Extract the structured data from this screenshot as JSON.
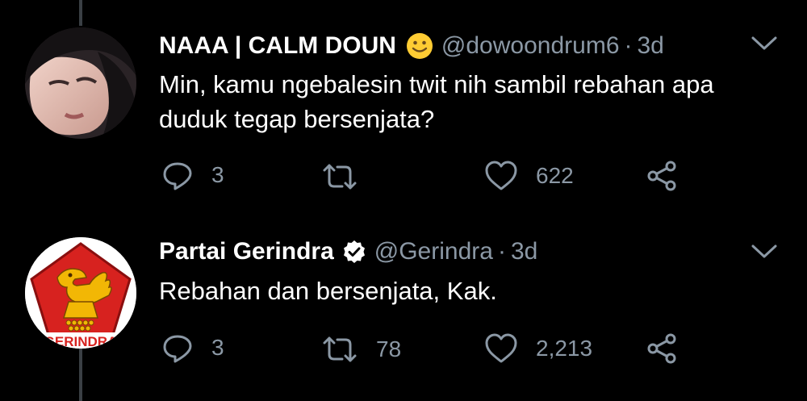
{
  "tweets": [
    {
      "display_name": "NAAA | CALM DOUN",
      "name_emoji": "slightly-smiling-face-emoji",
      "handle": "@dowoondrum6",
      "separator": "·",
      "time": "3d",
      "text": "Min, kamu ngebalesin twit nih sambil rebahan apa duduk tegap bersenjata?",
      "replies": "3",
      "retweets": "",
      "likes": "622"
    },
    {
      "display_name": "Partai Gerindra",
      "verified": true,
      "handle": "@Gerindra",
      "separator": "·",
      "time": "3d",
      "text": "Rebahan dan bersenjata, Kak.",
      "replies": "3",
      "retweets": "78",
      "likes": "2,213",
      "avatar_logo_text": "GERINDRA"
    }
  ],
  "colors": {
    "background": "#000000",
    "text_primary": "#ffffff",
    "text_secondary": "#8b98a5",
    "thread_line": "#3a3f44",
    "gerindra_red": "#d7221f",
    "gerindra_gold": "#f2b705",
    "emoji_yellow": "#ffcc33",
    "verified_badge": "#ffffff"
  },
  "icons": [
    "reply-icon",
    "retweet-icon",
    "like-icon",
    "share-icon",
    "chevron-down-icon",
    "verified-badge-icon"
  ]
}
